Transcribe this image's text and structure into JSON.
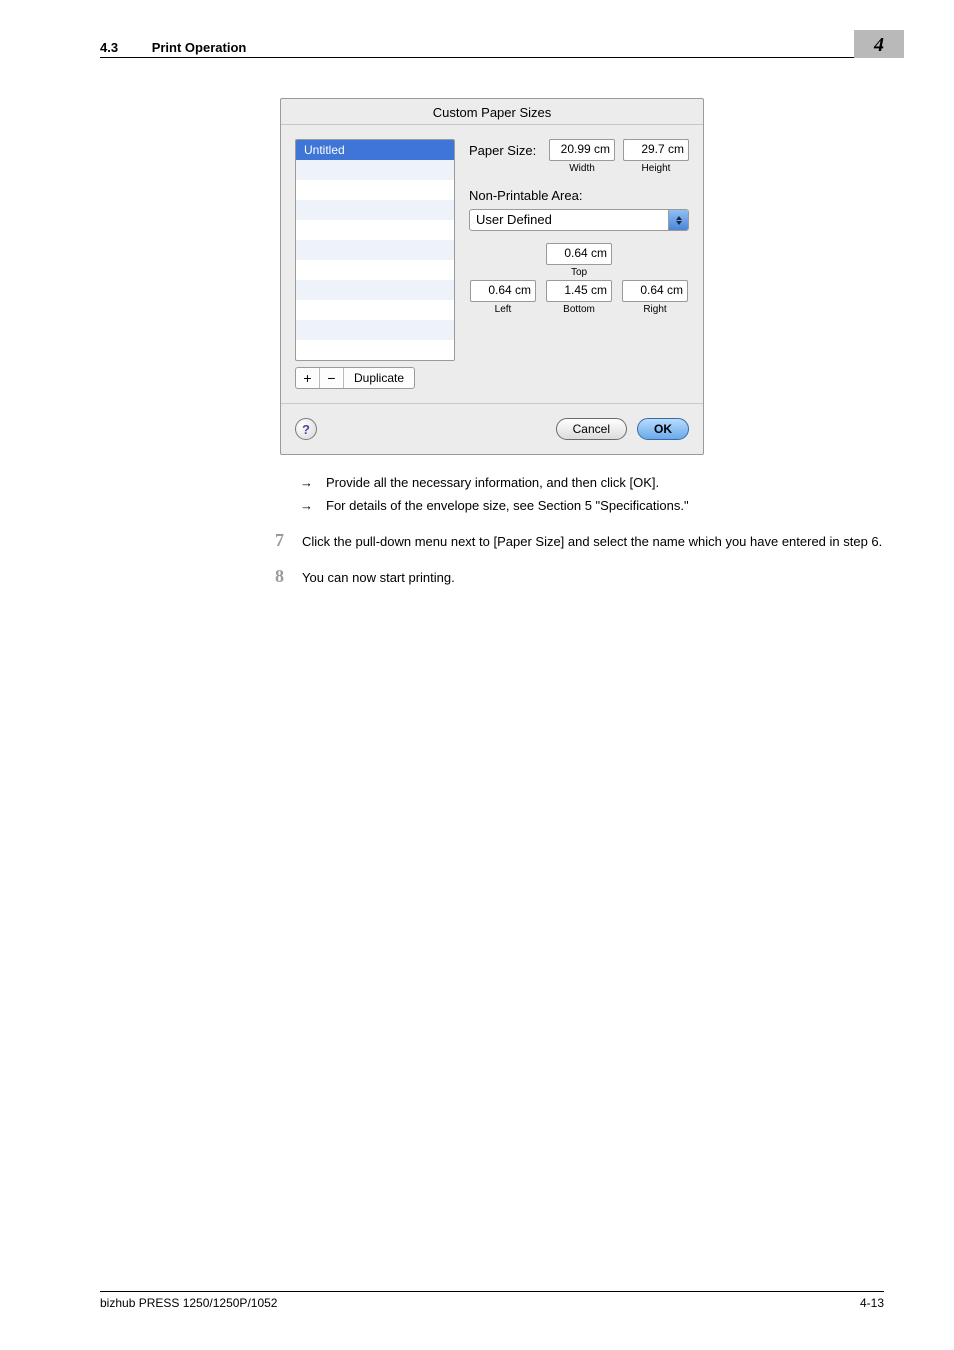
{
  "header": {
    "section_number": "4.3",
    "section_title": "Print Operation",
    "chapter_number": "4"
  },
  "dialog": {
    "title": "Custom Paper Sizes",
    "list": {
      "selected_item": "Untitled",
      "add_label": "+",
      "remove_label": "−",
      "duplicate_label": "Duplicate"
    },
    "paper_size": {
      "label": "Paper Size:",
      "width_value": "20.99 cm",
      "width_label": "Width",
      "height_value": "29.7 cm",
      "height_label": "Height"
    },
    "npa": {
      "label": "Non-Printable Area:",
      "select_value": "User Defined"
    },
    "margins": {
      "top_value": "0.64 cm",
      "top_label": "Top",
      "left_value": "0.64 cm",
      "left_label": "Left",
      "right_value": "0.64 cm",
      "right_label": "Right",
      "bottom_value": "1.45 cm",
      "bottom_label": "Bottom"
    },
    "buttons": {
      "help": "?",
      "cancel": "Cancel",
      "ok": "OK"
    }
  },
  "bullets": {
    "b1": "Provide all the necessary information, and then click [OK].",
    "b2": "For details of the envelope size, see Section 5 \"Specifications.\""
  },
  "steps": {
    "s7_num": "7",
    "s7_text": "Click the pull-down menu next to [Paper Size] and select the name which you have entered in step 6.",
    "s8_num": "8",
    "s8_text": "You can now start printing."
  },
  "footer": {
    "left": "bizhub PRESS 1250/1250P/1052",
    "right": "4-13"
  }
}
